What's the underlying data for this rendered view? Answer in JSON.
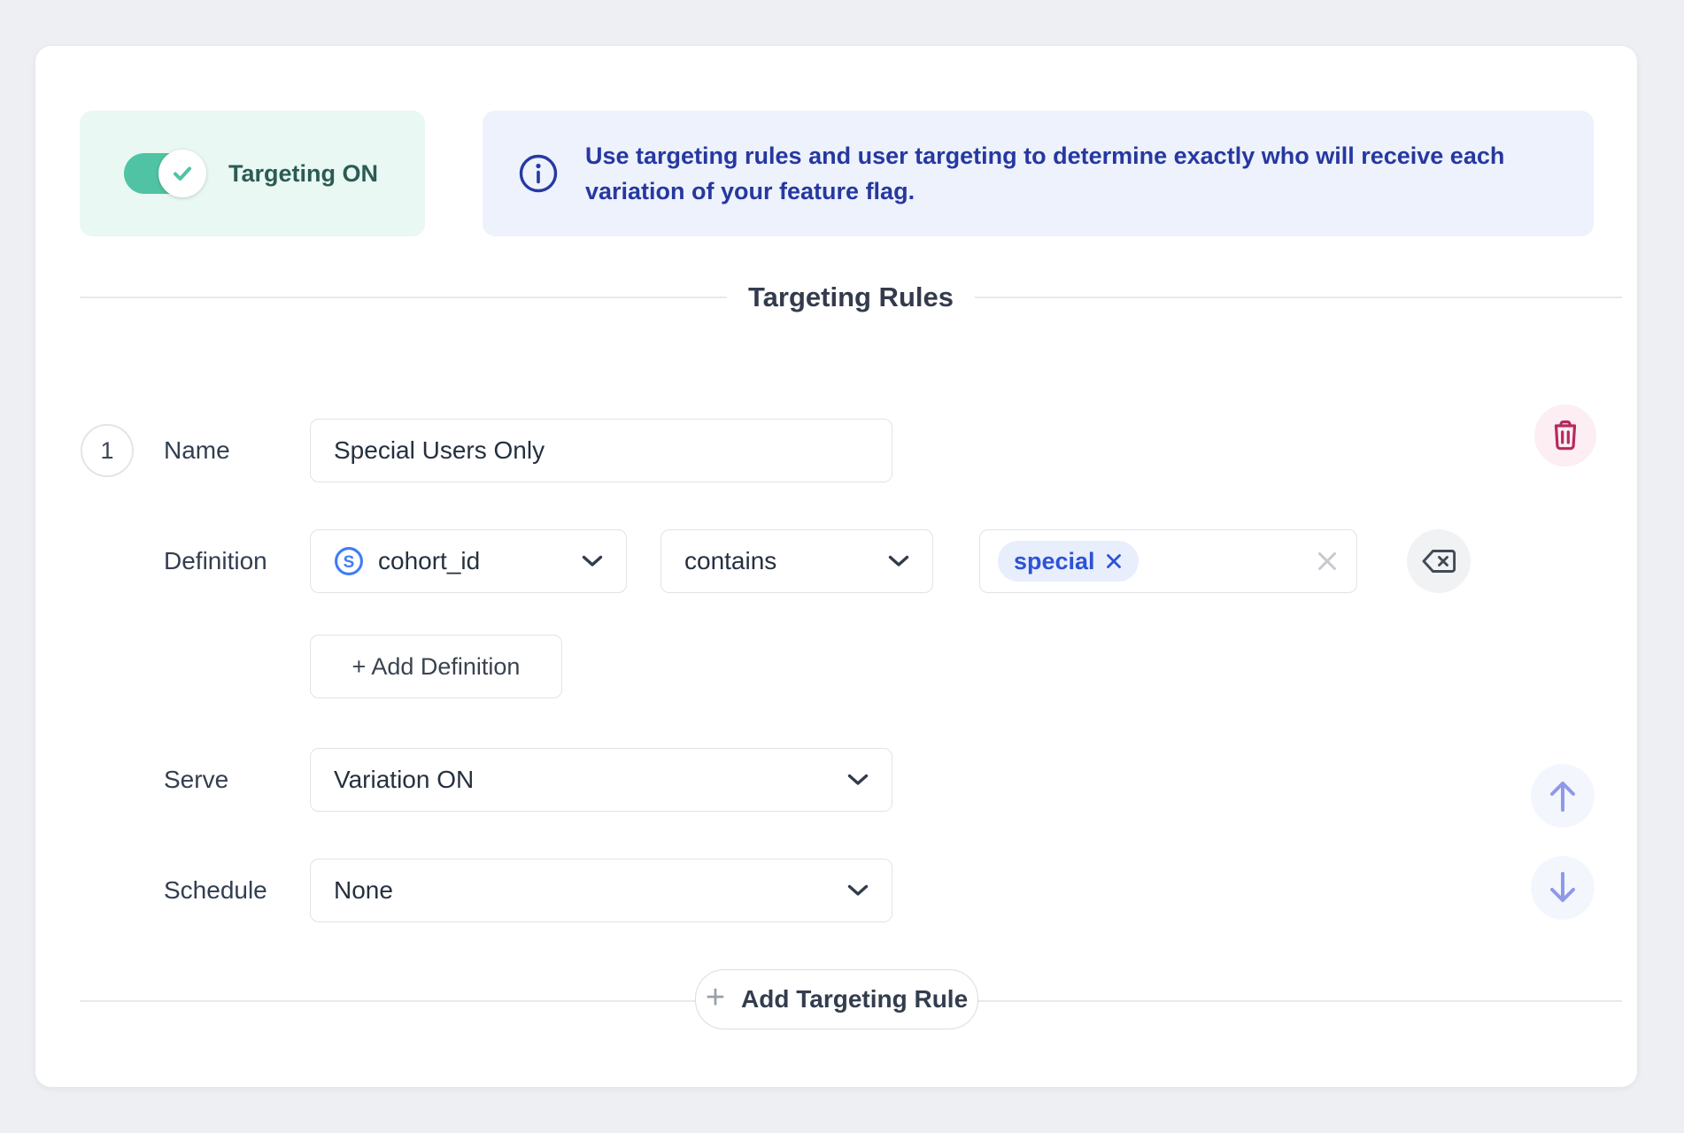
{
  "toggle": {
    "label": "Targeting ON",
    "state": "on"
  },
  "banner": {
    "text": "Use targeting rules and user targeting to determine exactly who will receive each variation of your feature flag."
  },
  "section": {
    "title": "Targeting Rules"
  },
  "rule": {
    "index": "1",
    "name_label": "Name",
    "name_value": "Special Users Only",
    "definition_label": "Definition",
    "attribute_value": "cohort_id",
    "operator_value": "contains",
    "chips": [
      "special"
    ],
    "add_definition_label": "+ Add Definition",
    "serve_label": "Serve",
    "serve_value": "Variation ON",
    "schedule_label": "Schedule",
    "schedule_value": "None"
  },
  "footer": {
    "add_rule_label": "Add Targeting Rule",
    "plus": "+"
  },
  "icons": {
    "toggle_knob": "check-icon",
    "banner": "info-icon",
    "attribute": "statsig-s-icon",
    "selects": "chevron-down-icon",
    "chip_remove": "x-icon",
    "tag_clear": "x-icon",
    "row_delete": "trash-icon",
    "definition_clear": "backspace-icon",
    "move_up": "arrow-up-icon",
    "move_down": "arrow-down-icon",
    "add_rule": "plus-icon"
  },
  "colors": {
    "page_bg": "#edeff2",
    "card_bg": "#ffffff",
    "toggle_box_bg": "#e9f8f2",
    "toggle_on": "#4fc3a3",
    "toggle_label": "#2b5b54",
    "banner_bg": "#edf2fc",
    "banner_text": "#2638a0",
    "heading_text": "#333b4c",
    "label_text": "#333e4f",
    "value_text": "#25303f",
    "control_border": "#dfe3e9",
    "divider": "#e7e9ed",
    "chip_bg": "#e8eefc",
    "chip_text": "#2d53d6",
    "trash_bg": "#fdeef3",
    "trash_icon": "#b62a5e",
    "arrow_bg": "#f3f7fd",
    "arrow_icon": "#8e99e8",
    "backspace_bg": "#f0f2f4",
    "backspace_icon": "#424a57",
    "statsig_blue": "#3f7cf6",
    "clear_x": "#c5cad1"
  }
}
